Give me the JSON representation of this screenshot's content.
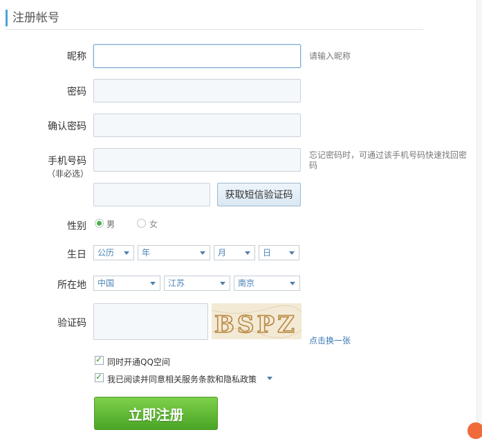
{
  "header": {
    "title": "注册帐号"
  },
  "form": {
    "nickname": {
      "label": "昵称",
      "value": "",
      "placeholder": "",
      "hint": "请输入昵称"
    },
    "password": {
      "label": "密码",
      "value": ""
    },
    "confirm_password": {
      "label": "确认密码",
      "value": ""
    },
    "phone": {
      "label": "手机号码",
      "sublabel": "（非必选）",
      "value": "",
      "hint": "忘记密码时，可通过该手机号码快速找回密码"
    },
    "sms_code": {
      "value": "",
      "button_label": "获取短信验证码"
    },
    "gender": {
      "label": "性别",
      "options": [
        {
          "label": "男",
          "checked": true
        },
        {
          "label": "女",
          "checked": false
        }
      ]
    },
    "birthday": {
      "label": "生日",
      "calendar": "公历",
      "year": "年",
      "month": "月",
      "day": "日"
    },
    "location": {
      "label": "所在地",
      "country": "中国",
      "province": "江苏",
      "city": "南京"
    },
    "captcha": {
      "label": "验证码",
      "value": "",
      "image_text": "BSPZ",
      "refresh_link": "点击换一张"
    },
    "checkboxes": [
      {
        "label": "同时开通QQ空间",
        "checked": true
      },
      {
        "label": "我已阅读并同意相关服务条款和隐私政策",
        "checked": true
      }
    ],
    "submit_label": "立即注册"
  },
  "colors": {
    "accent": "#4aa3d8",
    "submit_green": "#5cb531",
    "link_blue": "#3a78b8"
  }
}
